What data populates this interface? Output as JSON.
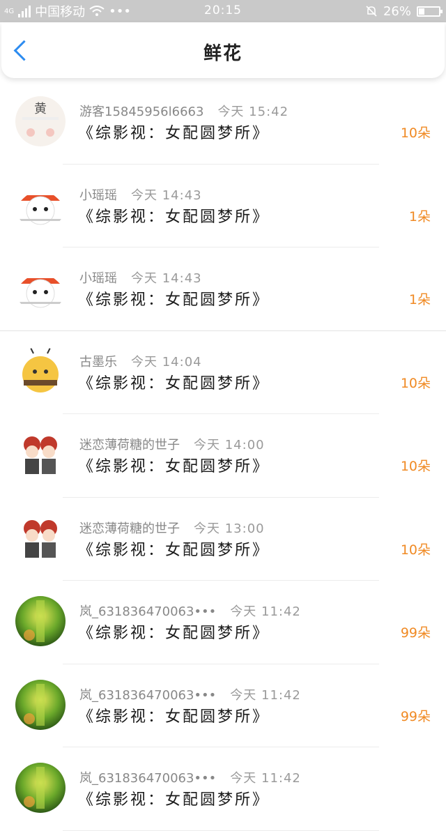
{
  "status_bar": {
    "network": "4G",
    "carrier": "中国移动",
    "more": "•••",
    "time": "20:15",
    "battery": "26%",
    "battery_level": 0.26
  },
  "header": {
    "title": "鲜花"
  },
  "colors": {
    "accent": "#2d8cf0",
    "count": "#f08a24"
  },
  "items": [
    {
      "user": "游客15845956l6663",
      "time": "今天 15:42",
      "book": "《综影视：女配圆梦所》",
      "count": "10朵",
      "avatar": "yellow-character"
    },
    {
      "user": "小瑶瑶",
      "time": "今天 14:43",
      "book": "《综影视：女配圆梦所》",
      "count": "1朵",
      "avatar": "panda-red-hat"
    },
    {
      "user": "小瑶瑶",
      "time": "今天 14:43",
      "book": "《综影视：女配圆梦所》",
      "count": "1朵",
      "avatar": "panda-red-hat"
    },
    {
      "user": "古墨乐",
      "time": "今天 14:04",
      "book": "《综影视：女配圆梦所》",
      "count": "10朵",
      "avatar": "yellow-bee"
    },
    {
      "user": "迷恋薄荷糖的世子",
      "time": "今天 14:00",
      "book": "《综影视：女配圆梦所》",
      "count": "10朵",
      "avatar": "two-girls"
    },
    {
      "user": "迷恋薄荷糖的世子",
      "time": "今天 13:00",
      "book": "《综影视：女配圆梦所》",
      "count": "10朵",
      "avatar": "two-girls"
    },
    {
      "user": "岚_631836470063•••",
      "time": "今天 11:42",
      "book": "《综影视：女配圆梦所》",
      "count": "99朵",
      "avatar": "green-nature"
    },
    {
      "user": "岚_631836470063•••",
      "time": "今天 11:42",
      "book": "《综影视：女配圆梦所》",
      "count": "99朵",
      "avatar": "green-nature"
    },
    {
      "user": "岚_631836470063•••",
      "time": "今天 11:42",
      "book": "《综影视：女配圆梦所》",
      "count": "",
      "avatar": "green-nature"
    }
  ]
}
